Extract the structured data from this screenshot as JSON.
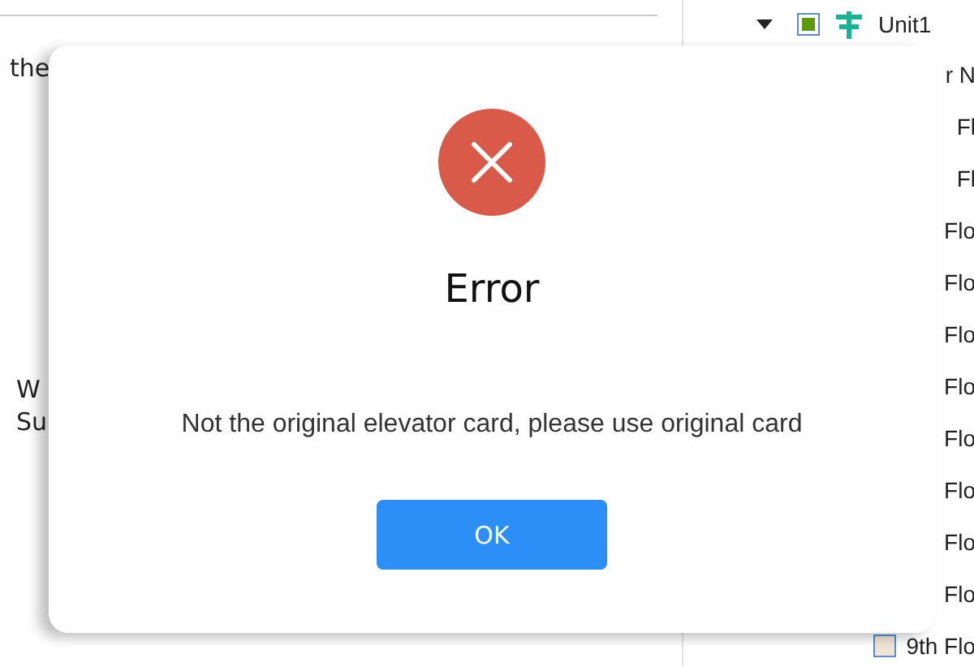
{
  "left_panel": {
    "top_text": "the",
    "bottom_texts": [
      "W",
      "Su"
    ]
  },
  "tree": {
    "root": {
      "label": "Unit1",
      "expanded": true,
      "checked": true
    },
    "children": [
      {
        "kind": "text",
        "label": "r N"
      },
      {
        "kind": "text",
        "label": "Fl"
      },
      {
        "kind": "text",
        "label": "Fl"
      },
      {
        "kind": "text",
        "label": "Flo"
      },
      {
        "kind": "text",
        "label": "Flo"
      },
      {
        "kind": "text",
        "label": "Flo"
      },
      {
        "kind": "text",
        "label": "Flo"
      },
      {
        "kind": "text",
        "label": "Flo"
      },
      {
        "kind": "text",
        "label": "Flo"
      },
      {
        "kind": "text",
        "label": "Flo"
      },
      {
        "kind": "text",
        "label": "Flo"
      },
      {
        "kind": "checkbox",
        "label": "9th Flo",
        "checked": false
      }
    ]
  },
  "dialog": {
    "title": "Error",
    "message": "Not the original elevator card, please use original card",
    "buttons": [
      {
        "label": "OK"
      }
    ]
  }
}
